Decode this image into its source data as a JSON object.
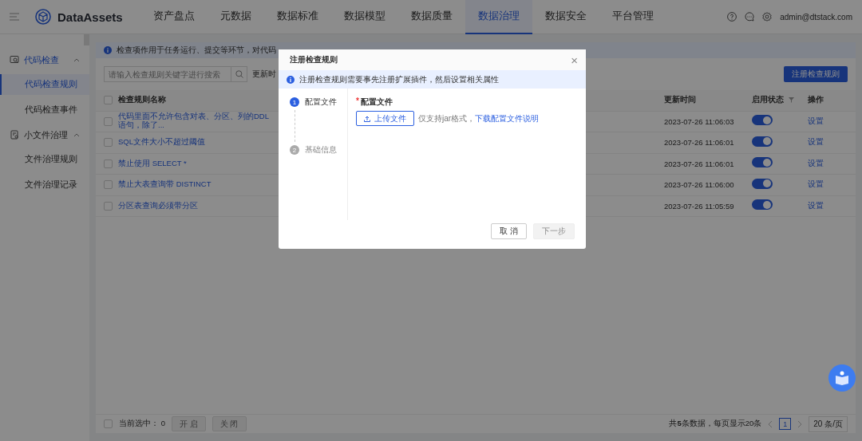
{
  "header": {
    "brand": "DataAssets",
    "nav": [
      {
        "label": "资产盘点",
        "selected": false
      },
      {
        "label": "元数据",
        "selected": false
      },
      {
        "label": "数据标准",
        "selected": false
      },
      {
        "label": "数据模型",
        "selected": false
      },
      {
        "label": "数据质量",
        "selected": false
      },
      {
        "label": "数据治理",
        "selected": true
      },
      {
        "label": "数据安全",
        "selected": false
      },
      {
        "label": "平台管理",
        "selected": false
      }
    ],
    "user": "admin@dtstack.com"
  },
  "sidebar": {
    "groups": [
      {
        "label": "代码检查",
        "kind": "code",
        "expanded": true,
        "children": [
          {
            "label": "代码检查规则",
            "selected": true
          },
          {
            "label": "代码检查事件",
            "selected": false
          }
        ]
      },
      {
        "label": "小文件治理",
        "kind": "file",
        "expanded": true,
        "children": [
          {
            "label": "文件治理规则",
            "selected": false
          },
          {
            "label": "文件治理记录",
            "selected": false
          }
        ]
      }
    ]
  },
  "banner": "检查项作用于任务运行、提交等环节，对代码",
  "toolbar": {
    "search_placeholder": "请输入检查规则关键字进行搜索",
    "filter_label": "更新时",
    "register_button": "注册检查规则"
  },
  "table": {
    "header_checked": false,
    "columns": {
      "name": "检查规则名称",
      "updated": "更新时间",
      "status": "启用状态",
      "action": "操作"
    },
    "rows": [
      {
        "checked": false,
        "name": "代码里面不允许包含对表、分区、列的DDL 语句，除了...",
        "updated": "2023-07-26 11:06:03",
        "enabled": true,
        "action": "设置"
      },
      {
        "checked": false,
        "name": "SQL文件大小不超过阈值",
        "updated": "2023-07-26 11:06:01",
        "enabled": true,
        "action": "设置"
      },
      {
        "checked": false,
        "name": "禁止使用 SELECT *",
        "updated": "2023-07-26 11:06:01",
        "enabled": true,
        "action": "设置"
      },
      {
        "checked": false,
        "name": "禁止大表查询带 DISTINCT",
        "updated": "2023-07-26 11:06:00",
        "enabled": true,
        "action": "设置"
      },
      {
        "checked": false,
        "name": "分区表查询必须带分区",
        "updated": "2023-07-26 11:05:59",
        "enabled": true,
        "action": "设置"
      }
    ]
  },
  "footer": {
    "select_all_checked": false,
    "selected_label": "当前选中：",
    "selected_count": "0",
    "buttons": [
      "开 启",
      "关 闭"
    ],
    "summary": "共**5**条数据，每页显示20条",
    "page": "1",
    "page_size": "20 条/页"
  },
  "modal": {
    "title": "注册检查规则",
    "close": "×",
    "notice": "注册检查规则需要事先注册扩展插件，然后设置相关属性",
    "steps": [
      {
        "number": "1",
        "label": "配置文件",
        "selected": true
      },
      {
        "number": "2",
        "label": "基础信息",
        "selected": false
      }
    ],
    "field_label": "配置文件",
    "required_mark": "*",
    "upload_button": "上传文件",
    "hint": "仅支持jar格式，",
    "hint_link": "下载配置文件说明",
    "buttons": [
      {
        "label": "取 消",
        "disabled": false
      },
      {
        "label": "下一步",
        "disabled": true
      }
    ]
  }
}
